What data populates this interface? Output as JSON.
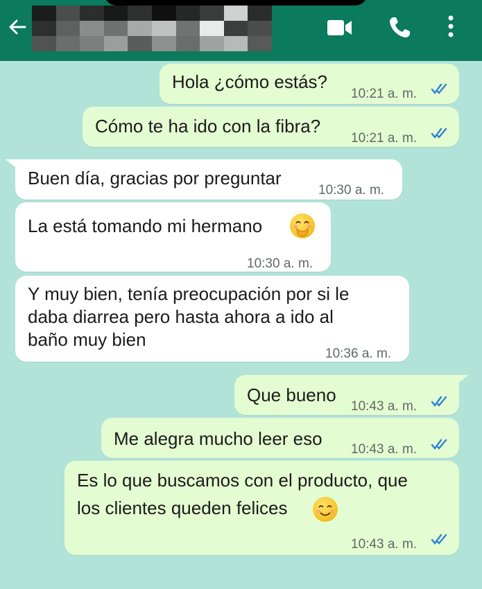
{
  "header": {
    "back_icon": "arrow-left-icon",
    "contact_name": "",
    "video_icon": "video-call-icon",
    "phone_icon": "voice-call-icon",
    "menu_icon": "more-vertical-icon",
    "bg_color": "#0b7a5d"
  },
  "chat_bg": "#b2e3d9",
  "messages": [
    {
      "dir": "out",
      "text": "Hola ¿cómo estás?",
      "time": "10:21 a. m.",
      "status": "read-double-tick-icon"
    },
    {
      "dir": "out",
      "text": "Cómo te ha ido con la fibra?",
      "time": "10:21 a. m.",
      "status": "read-double-tick-icon"
    },
    {
      "dir": "in",
      "text": "Buen día, gracias por preguntar",
      "time": "10:30 a. m."
    },
    {
      "dir": "in",
      "text": "La está tomando mi hermano",
      "emoji": "face-with-hand-over-mouth-emoji",
      "time": "10:30 a. m."
    },
    {
      "dir": "in",
      "lines": [
        "Y muy bien, tenía preocupación por si le",
        "daba diarrea pero hasta ahora a ido al",
        "baño muy bien"
      ],
      "time": "10:36 a. m."
    },
    {
      "dir": "out",
      "text": "Que bueno",
      "time": "10:43 a. m.",
      "status": "read-double-tick-icon"
    },
    {
      "dir": "out",
      "text": "Me alegra mucho leer eso",
      "time": "10:43 a. m.",
      "status": "read-double-tick-icon"
    },
    {
      "dir": "out",
      "lines": [
        "Es lo que buscamos con el producto, que",
        "los clientes queden felices"
      ],
      "emoji": "smiling-face-with-smiling-eyes-emoji",
      "time": "10:43 a. m.",
      "status": "read-double-tick-icon"
    }
  ],
  "colors": {
    "outgoing": "#e4fcd1",
    "incoming": "#ffffff",
    "tick": "#2f83d6"
  }
}
